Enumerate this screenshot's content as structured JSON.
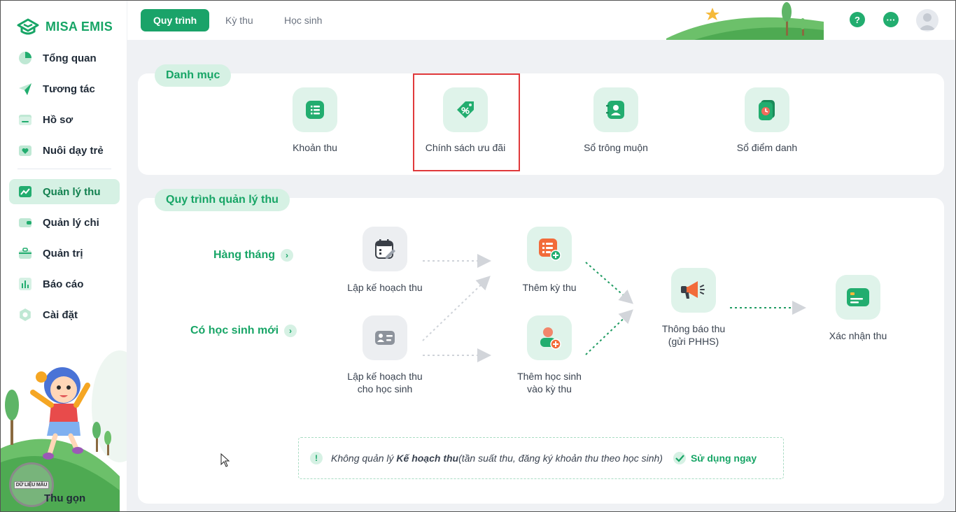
{
  "brand": {
    "name": "MISA EMIS"
  },
  "sidebar": {
    "items": [
      {
        "label": "Tổng quan",
        "icon": "pie-chart-icon"
      },
      {
        "label": "Tương tác",
        "icon": "paper-plane-icon"
      },
      {
        "label": "Hồ sơ",
        "icon": "folder-icon"
      },
      {
        "label": "Nuôi dạy trẻ",
        "icon": "heart-folder-icon"
      },
      {
        "label": "Quản lý thu",
        "icon": "trend-chart-icon",
        "active": true
      },
      {
        "label": "Quản lý chi",
        "icon": "wallet-icon"
      },
      {
        "label": "Quản trị",
        "icon": "briefcase-icon"
      },
      {
        "label": "Báo cáo",
        "icon": "bar-chart-icon"
      },
      {
        "label": "Cài đặt",
        "icon": "gear-icon"
      }
    ],
    "collapse_label": "Thu gọn",
    "watermark": "DỮ LIỆU MẪU"
  },
  "topbar": {
    "tabs": [
      {
        "label": "Quy trình",
        "active": true
      },
      {
        "label": "Kỳ thu"
      },
      {
        "label": "Học sinh"
      }
    ],
    "help_icon": "?",
    "more_icon": "···"
  },
  "catalog": {
    "title": "Danh mục",
    "items": [
      {
        "label": "Khoản thu",
        "icon": "receipt-icon"
      },
      {
        "label": "Chính sách ưu đãi",
        "icon": "discount-tag-icon"
      },
      {
        "label": "Sổ trông muộn",
        "icon": "contact-book-icon"
      },
      {
        "label": "Sổ điểm danh",
        "icon": "attendance-clock-icon"
      }
    ]
  },
  "process": {
    "title": "Quy trình quản lý thu",
    "row_labels": {
      "monthly": "Hàng tháng",
      "new_student": "Có học sinh mới"
    },
    "steps": {
      "plan": "Lập kế hoạch thu",
      "plan_student_1": "Lập kế hoạch thu",
      "plan_student_2": "cho học sinh",
      "add_period": "Thêm kỳ thu",
      "add_student_1": "Thêm học sinh",
      "add_student_2": "vào kỳ thu",
      "notify_1": "Thông báo thu",
      "notify_2": "(gửi PHHS)",
      "confirm": "Xác nhận thu"
    }
  },
  "notice": {
    "prefix": "Không quản lý ",
    "bold": "Kế hoạch thu",
    "suffix": " (tần suất thu, đăng ký khoản thu theo học sinh)",
    "action": "Sử dụng ngay"
  },
  "colors": {
    "accent": "#17a566",
    "accent_light": "#d6f1e4",
    "highlight": "#e0393b"
  }
}
